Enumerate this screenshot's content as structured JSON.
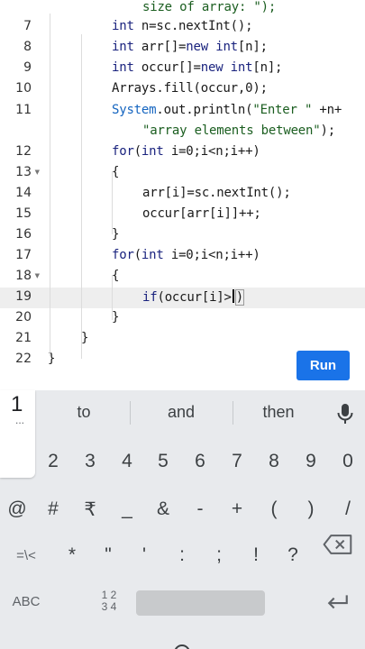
{
  "editor": {
    "lines": [
      {
        "no": "",
        "fold": false,
        "active": false,
        "cont": true,
        "parts": [
          {
            "t": "size of array: \");",
            "c": "str"
          }
        ]
      },
      {
        "no": "7",
        "fold": false,
        "active": false,
        "parts": [
          {
            "t": "int",
            "c": "kw"
          },
          {
            "t": " n=sc.nextInt();",
            "c": ""
          }
        ]
      },
      {
        "no": "8",
        "fold": false,
        "active": false,
        "parts": [
          {
            "t": "int",
            "c": "kw"
          },
          {
            "t": " arr[]=",
            "c": ""
          },
          {
            "t": "new",
            "c": "kw"
          },
          {
            "t": " ",
            "c": ""
          },
          {
            "t": "int",
            "c": "kw"
          },
          {
            "t": "[n];",
            "c": ""
          }
        ]
      },
      {
        "no": "9",
        "fold": false,
        "active": false,
        "parts": [
          {
            "t": "int",
            "c": "kw"
          },
          {
            "t": " occur[]=",
            "c": ""
          },
          {
            "t": "new",
            "c": "kw"
          },
          {
            "t": " ",
            "c": ""
          },
          {
            "t": "int",
            "c": "kw"
          },
          {
            "t": "[n];",
            "c": ""
          }
        ]
      },
      {
        "no": "10",
        "fold": false,
        "active": false,
        "parts": [
          {
            "t": "Arrays.fill(occur,0);",
            "c": ""
          }
        ]
      },
      {
        "no": "11",
        "fold": false,
        "active": false,
        "parts": [
          {
            "t": "System",
            "c": "cls"
          },
          {
            "t": ".out.println(",
            "c": ""
          },
          {
            "t": "\"Enter \"",
            "c": "str"
          },
          {
            "t": " +n+",
            "c": ""
          }
        ]
      },
      {
        "no": "",
        "fold": false,
        "active": false,
        "cont": true,
        "parts": [
          {
            "t": "\"array elements between\"",
            "c": "str"
          },
          {
            "t": ");",
            "c": ""
          }
        ]
      },
      {
        "no": "12",
        "fold": false,
        "active": false,
        "parts": [
          {
            "t": "for",
            "c": "kw"
          },
          {
            "t": "(",
            "c": ""
          },
          {
            "t": "int",
            "c": "kw"
          },
          {
            "t": " i=0;i<n;i++)",
            "c": ""
          }
        ]
      },
      {
        "no": "13",
        "fold": true,
        "active": false,
        "parts": [
          {
            "t": "{",
            "c": ""
          }
        ]
      },
      {
        "no": "14",
        "fold": false,
        "active": false,
        "parts": [
          {
            "t": "arr[i]=sc.nextInt();",
            "c": ""
          }
        ]
      },
      {
        "no": "15",
        "fold": false,
        "active": false,
        "parts": [
          {
            "t": "occur[arr[i]]++;",
            "c": ""
          }
        ]
      },
      {
        "no": "16",
        "fold": false,
        "active": false,
        "parts": [
          {
            "t": "}",
            "c": ""
          }
        ]
      },
      {
        "no": "17",
        "fold": false,
        "active": false,
        "parts": [
          {
            "t": "for",
            "c": "kw"
          },
          {
            "t": "(",
            "c": ""
          },
          {
            "t": "int",
            "c": "kw"
          },
          {
            "t": " i=0;i<n;i++)",
            "c": ""
          }
        ]
      },
      {
        "no": "18",
        "fold": true,
        "active": false,
        "parts": [
          {
            "t": "{",
            "c": ""
          }
        ]
      },
      {
        "no": "19",
        "fold": false,
        "active": true,
        "parts": [
          {
            "t": "if",
            "c": "kw"
          },
          {
            "t": "(occur[i]>",
            "c": ""
          },
          {
            "t": "|",
            "c": "cursor"
          },
          {
            "t": ")",
            "c": "box"
          }
        ]
      },
      {
        "no": "20",
        "fold": false,
        "active": false,
        "parts": [
          {
            "t": "}",
            "c": ""
          }
        ]
      },
      {
        "no": "21",
        "fold": false,
        "active": false,
        "parts": [
          {
            "t": "}",
            "c": ""
          }
        ]
      },
      {
        "no": "22",
        "fold": false,
        "active": false,
        "parts": [
          {
            "t": "}",
            "c": ""
          }
        ]
      }
    ],
    "run_label": "Run"
  },
  "keyboard": {
    "suggestions": [
      "to",
      "and",
      "then"
    ],
    "number_tile": {
      "digit": "1",
      "dots": "..."
    },
    "number_row": [
      "2",
      "3",
      "4",
      "5",
      "6",
      "7",
      "8",
      "9",
      "0"
    ],
    "symbol_row1": [
      "@",
      "#",
      "₹",
      "_",
      "&",
      "-",
      "+",
      "(",
      ")",
      "/"
    ],
    "symbol_row2": [
      "=\\<",
      "*",
      "\"",
      "'",
      ":",
      ";",
      "!",
      "?"
    ],
    "abc_label": "ABC",
    "numpad_label_top": "1 2",
    "numpad_label_bottom": "3 4",
    "icons": {
      "mic": "mic-icon",
      "backspace": "backspace-icon",
      "enter": "enter-icon"
    }
  }
}
